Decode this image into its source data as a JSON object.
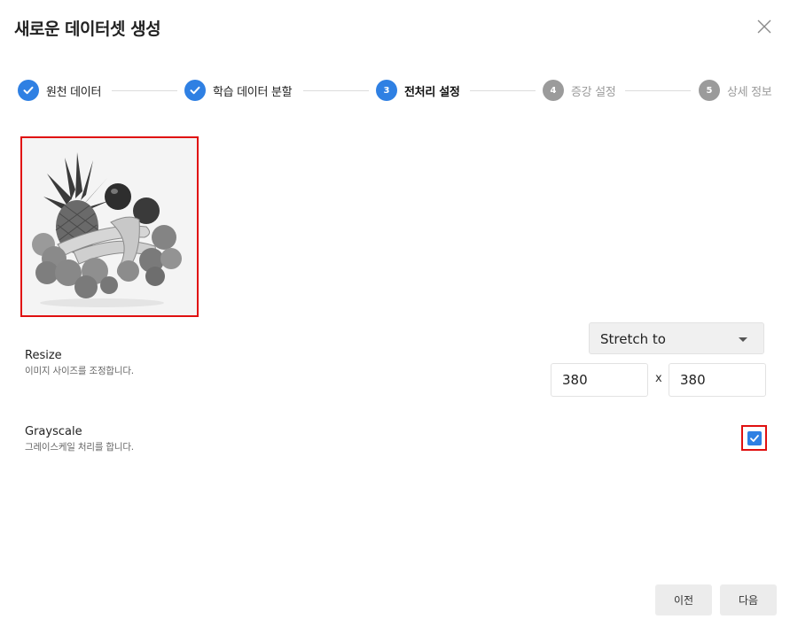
{
  "dialog": {
    "title": "새로운 데이터셋 생성"
  },
  "steps": [
    {
      "number": "1",
      "label": "원천 데이터",
      "state": "done"
    },
    {
      "number": "2",
      "label": "학습 데이터 분할",
      "state": "done"
    },
    {
      "number": "3",
      "label": "전처리 설정",
      "state": "active"
    },
    {
      "number": "4",
      "label": "증강 설정",
      "state": "pending"
    },
    {
      "number": "5",
      "label": "상세 정보",
      "state": "pending"
    }
  ],
  "resize": {
    "title": "Resize",
    "description": "이미지 사이즈를 조정합니다.",
    "mode": "Stretch to",
    "width": "380",
    "separator": "x",
    "height": "380"
  },
  "grayscale": {
    "title": "Grayscale",
    "description": "그레이스케일 처리를 합니다.",
    "checked": true
  },
  "footer": {
    "prev_label": "이전",
    "next_label": "다음"
  },
  "colors": {
    "accent": "#2f80e3",
    "highlight": "#e01010",
    "pending": "#9b9b9b"
  }
}
